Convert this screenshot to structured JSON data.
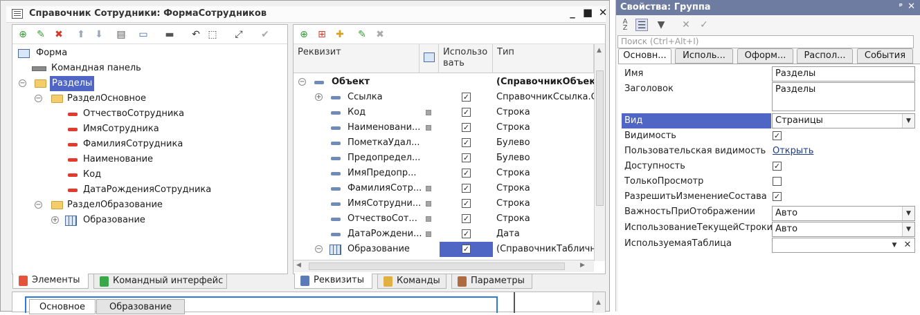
{
  "window": {
    "title": "Справочник Сотрудники: ФормаСотрудников",
    "min_label": "_",
    "max_label": "■",
    "close_label": "✕"
  },
  "elements_tree": {
    "root": "Форма",
    "items": [
      {
        "label": "Командная панель"
      },
      {
        "label": "Разделы",
        "selected": true
      },
      {
        "label": "РазделОсновное"
      },
      {
        "label": "ОтчествоСотрудника"
      },
      {
        "label": "ИмяСотрудника"
      },
      {
        "label": "ФамилияСотрудника"
      },
      {
        "label": "Наименование"
      },
      {
        "label": "Код"
      },
      {
        "label": "ДатаРожденияСотрудника"
      },
      {
        "label": "РазделОбразование"
      },
      {
        "label": "Образование"
      }
    ]
  },
  "left_tabs": {
    "elements": "Элементы",
    "command_interface": "Командный интерфейс"
  },
  "attributes": {
    "headers": {
      "attr": "Реквизит",
      "use": "Использо\nвать",
      "type": "Тип"
    },
    "rows": [
      {
        "name": "Объект",
        "type": "(СправочникОбъект",
        "bold": true
      },
      {
        "name": "Ссылка",
        "type": "СправочникСсылка.С"
      },
      {
        "name": "Код",
        "type": "Строка"
      },
      {
        "name": "Наименовани...",
        "type": "Строка"
      },
      {
        "name": "ПометкаУдал...",
        "type": "Булево"
      },
      {
        "name": "Предопредел...",
        "type": "Булево"
      },
      {
        "name": "ИмяПредопр...",
        "type": "Строка"
      },
      {
        "name": "ФамилияСотр...",
        "type": "Строка"
      },
      {
        "name": "ИмяСотрудни...",
        "type": "Строка"
      },
      {
        "name": "ОтчествоСот...",
        "type": "Строка"
      },
      {
        "name": "ДатаРождени...",
        "type": "Дата"
      },
      {
        "name": "Образование",
        "type": "(СправочникТабличн"
      }
    ]
  },
  "mid_tabs": {
    "attributes": "Реквизиты",
    "commands": "Команды",
    "parameters": "Параметры"
  },
  "preview_tabs": {
    "main": "Основное",
    "education": "Образование"
  },
  "properties": {
    "title": "Свойства: Группа",
    "pin_label": "ᵖ",
    "search_placeholder": "Поиск (Ctrl+Alt+I)",
    "tabs": [
      "Основн...",
      "Исполь...",
      "Оформ...",
      "Распол...",
      "События"
    ],
    "rows": {
      "name_label": "Имя",
      "name_value": "Разделы",
      "caption_label": "Заголовок",
      "caption_value": "Разделы",
      "view_label": "Вид",
      "view_value": "Страницы",
      "visible_label": "Видимость",
      "user_visible_label": "Пользовательская видимость",
      "user_visible_link": "Открыть",
      "enabled_label": "Доступность",
      "readonly_label": "ТолькоПросмотр",
      "allow_change_label": "РазрешитьИзменениеСостава",
      "importance_label": "ВажностьПриОтображении",
      "importance_value": "Авто",
      "current_row_label": "ИспользованиеТекущейСтроки",
      "current_row_value": "Авто",
      "table_label": "ИспользуемаяТаблица",
      "table_value": ""
    }
  },
  "colors": {
    "selection": "#5066c4",
    "title_bar": "#6e7ca1"
  }
}
